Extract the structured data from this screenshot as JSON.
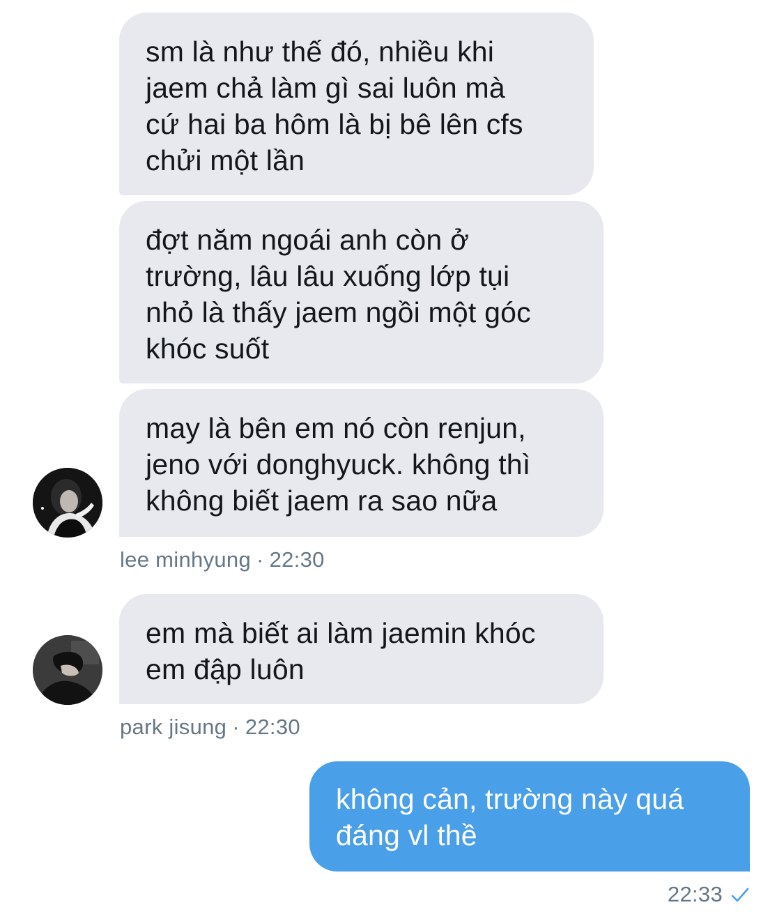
{
  "conversation": {
    "messages": [
      {
        "direction": "incoming",
        "text": "sm là như thế đó, nhiều khi\njaem chả làm gì sai luôn mà\ncứ hai ba hôm là bị bê lên cfs\nchửi một lần"
      },
      {
        "direction": "incoming",
        "text": "đợt năm ngoái anh còn ở\ntrường, lâu lâu xuống lớp tụi\nnhỏ là thấy jaem ngồi một góc\nkhóc suốt"
      },
      {
        "direction": "incoming",
        "text": "may là bên em nó còn renjun,\njeno với donghyuck. không thì\nkhông biết jaem ra sao nữa"
      },
      {
        "direction": "incoming",
        "text": "em mà biết ai làm jaemin khóc\nem đập luôn"
      },
      {
        "direction": "outgoing",
        "text": "không cản, trường này quá\nđáng vl thề"
      }
    ],
    "groups": [
      {
        "sender": "lee minhyung",
        "separator": "·",
        "time": "22:30"
      },
      {
        "sender": "park jisung",
        "separator": "·",
        "time": "22:30"
      }
    ],
    "own_meta": {
      "time": "22:33",
      "status_icon": "checkmark-icon"
    }
  },
  "colors": {
    "incoming_bubble": "#e7e9ef",
    "outgoing_bubble": "#4a9fe9",
    "meta_text": "#657786",
    "accent": "#4a9fe9"
  }
}
